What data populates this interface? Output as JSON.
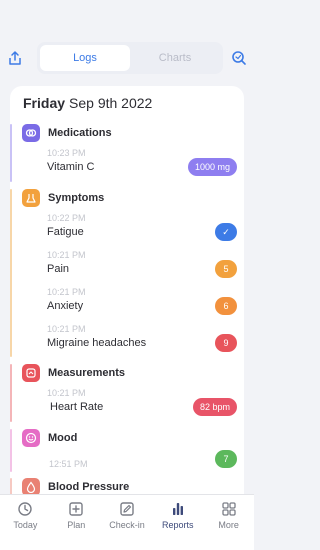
{
  "colors": {
    "accent": "#3d7be6",
    "medications": "#7a6be6",
    "symptoms": "#f2a13d",
    "measurements": "#e8545b",
    "mood": "#e56cc5",
    "blood_pressure": "#e98173"
  },
  "header": {
    "tabs": [
      {
        "label": "Logs",
        "active": true
      },
      {
        "label": "Charts",
        "active": false
      }
    ],
    "share_icon": "share-icon",
    "search_icon": "search-icon"
  },
  "log": {
    "day": "Friday",
    "date": "Sep 9th 2022",
    "sections": {
      "medications": {
        "title": "Medications",
        "icon": "pill-icon",
        "entries": [
          {
            "time": "10:23 PM",
            "label": "Vitamin C",
            "badge": "1000 mg",
            "badge_color": "#8e7ef0"
          }
        ]
      },
      "symptoms": {
        "title": "Symptoms",
        "icon": "symptom-icon",
        "entries": [
          {
            "time": "10:22 PM",
            "label": "Fatigue",
            "badge": "✓",
            "badge_color": "#3d7be6"
          },
          {
            "time": "10:21 PM",
            "label": "Pain",
            "badge": "5",
            "badge_color": "#f2a13d"
          },
          {
            "time": "10:21 PM",
            "label": "Anxiety",
            "badge": "6",
            "badge_color": "#f2913d"
          },
          {
            "time": "10:21 PM",
            "label": "Migraine headaches",
            "badge": "9",
            "badge_color": "#e8545b"
          }
        ]
      },
      "measurements": {
        "title": "Measurements",
        "icon": "measurement-icon",
        "entries": [
          {
            "time": "10:21 PM",
            "label": "Heart Rate",
            "badge": "82 bpm",
            "badge_color": "#e85468"
          }
        ]
      },
      "mood": {
        "title": "Mood",
        "icon": "smiley-icon",
        "entries": [
          {
            "time": "12:51 PM",
            "label": "",
            "badge": "7",
            "badge_color": "#5cb85c"
          }
        ]
      },
      "blood_pressure": {
        "title": "Blood Pressure",
        "icon": "blood-drop-icon"
      }
    }
  },
  "tabbar": {
    "items": [
      {
        "label": "Today",
        "icon": "clock-icon",
        "active": false
      },
      {
        "label": "Plan",
        "icon": "plus-square-icon",
        "active": false
      },
      {
        "label": "Check-in",
        "icon": "edit-icon",
        "active": false
      },
      {
        "label": "Reports",
        "icon": "bar-chart-icon",
        "active": true
      },
      {
        "label": "More",
        "icon": "grid-icon",
        "active": false
      }
    ]
  }
}
